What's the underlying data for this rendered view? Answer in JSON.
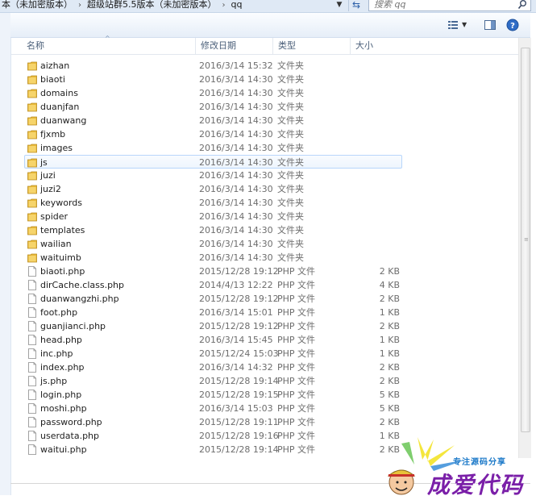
{
  "breadcrumb": {
    "items": [
      "本（未加密版本）",
      "超级站群5.5版本（未加密版本）",
      "qq"
    ],
    "separator": "›"
  },
  "search": {
    "placeholder": "搜索 qq"
  },
  "columns": {
    "name": "名称",
    "date": "修改日期",
    "type": "类型",
    "size": "大小"
  },
  "files": [
    {
      "name": "aizhan",
      "date": "2016/3/14 15:32",
      "type": "文件夹",
      "size": "",
      "kind": "folder"
    },
    {
      "name": "biaoti",
      "date": "2016/3/14 14:30",
      "type": "文件夹",
      "size": "",
      "kind": "folder"
    },
    {
      "name": "domains",
      "date": "2016/3/14 14:30",
      "type": "文件夹",
      "size": "",
      "kind": "folder"
    },
    {
      "name": "duanjfan",
      "date": "2016/3/14 14:30",
      "type": "文件夹",
      "size": "",
      "kind": "folder"
    },
    {
      "name": "duanwang",
      "date": "2016/3/14 14:30",
      "type": "文件夹",
      "size": "",
      "kind": "folder"
    },
    {
      "name": "fjxmb",
      "date": "2016/3/14 14:30",
      "type": "文件夹",
      "size": "",
      "kind": "folder"
    },
    {
      "name": "images",
      "date": "2016/3/14 14:30",
      "type": "文件夹",
      "size": "",
      "kind": "folder"
    },
    {
      "name": "js",
      "date": "2016/3/14 14:30",
      "type": "文件夹",
      "size": "",
      "kind": "folder",
      "selected": true
    },
    {
      "name": "juzi",
      "date": "2016/3/14 14:30",
      "type": "文件夹",
      "size": "",
      "kind": "folder"
    },
    {
      "name": "juzi2",
      "date": "2016/3/14 14:30",
      "type": "文件夹",
      "size": "",
      "kind": "folder"
    },
    {
      "name": "keywords",
      "date": "2016/3/14 14:30",
      "type": "文件夹",
      "size": "",
      "kind": "folder"
    },
    {
      "name": "spider",
      "date": "2016/3/14 14:30",
      "type": "文件夹",
      "size": "",
      "kind": "folder"
    },
    {
      "name": "templates",
      "date": "2016/3/14 14:30",
      "type": "文件夹",
      "size": "",
      "kind": "folder"
    },
    {
      "name": "wailian",
      "date": "2016/3/14 14:30",
      "type": "文件夹",
      "size": "",
      "kind": "folder"
    },
    {
      "name": "waituimb",
      "date": "2016/3/14 14:30",
      "type": "文件夹",
      "size": "",
      "kind": "folder"
    },
    {
      "name": "biaoti.php",
      "date": "2015/12/28 19:12",
      "type": "PHP 文件",
      "size": "2 KB",
      "kind": "file"
    },
    {
      "name": "dirCache.class.php",
      "date": "2014/4/13 12:22",
      "type": "PHP 文件",
      "size": "4 KB",
      "kind": "file"
    },
    {
      "name": "duanwangzhi.php",
      "date": "2015/12/28 19:12",
      "type": "PHP 文件",
      "size": "2 KB",
      "kind": "file"
    },
    {
      "name": "foot.php",
      "date": "2016/3/14 15:01",
      "type": "PHP 文件",
      "size": "1 KB",
      "kind": "file"
    },
    {
      "name": "guanjianci.php",
      "date": "2015/12/28 19:12",
      "type": "PHP 文件",
      "size": "2 KB",
      "kind": "file"
    },
    {
      "name": "head.php",
      "date": "2016/3/14 15:45",
      "type": "PHP 文件",
      "size": "1 KB",
      "kind": "file"
    },
    {
      "name": "inc.php",
      "date": "2015/12/24 15:03",
      "type": "PHP 文件",
      "size": "1 KB",
      "kind": "file"
    },
    {
      "name": "index.php",
      "date": "2016/3/14 14:32",
      "type": "PHP 文件",
      "size": "2 KB",
      "kind": "file"
    },
    {
      "name": "js.php",
      "date": "2015/12/28 19:14",
      "type": "PHP 文件",
      "size": "2 KB",
      "kind": "file"
    },
    {
      "name": "login.php",
      "date": "2015/12/28 19:15",
      "type": "PHP 文件",
      "size": "5 KB",
      "kind": "file"
    },
    {
      "name": "moshi.php",
      "date": "2016/3/14 15:03",
      "type": "PHP 文件",
      "size": "5 KB",
      "kind": "file"
    },
    {
      "name": "password.php",
      "date": "2015/12/28 19:11",
      "type": "PHP 文件",
      "size": "2 KB",
      "kind": "file"
    },
    {
      "name": "userdata.php",
      "date": "2015/12/28 19:16",
      "type": "PHP 文件",
      "size": "1 KB",
      "kind": "file"
    },
    {
      "name": "waitui.php",
      "date": "2015/12/28 19:14",
      "type": "PHP 文件",
      "size": "2 KB",
      "kind": "file"
    }
  ],
  "watermark": {
    "tagline": "专注源码分享",
    "brand": "成爱代码"
  },
  "colors": {
    "folder": "#e8b93a",
    "selection_border": "#b8d6fb",
    "watermark_blue": "#1a78c8",
    "watermark_purple": "#7a1fa8"
  }
}
